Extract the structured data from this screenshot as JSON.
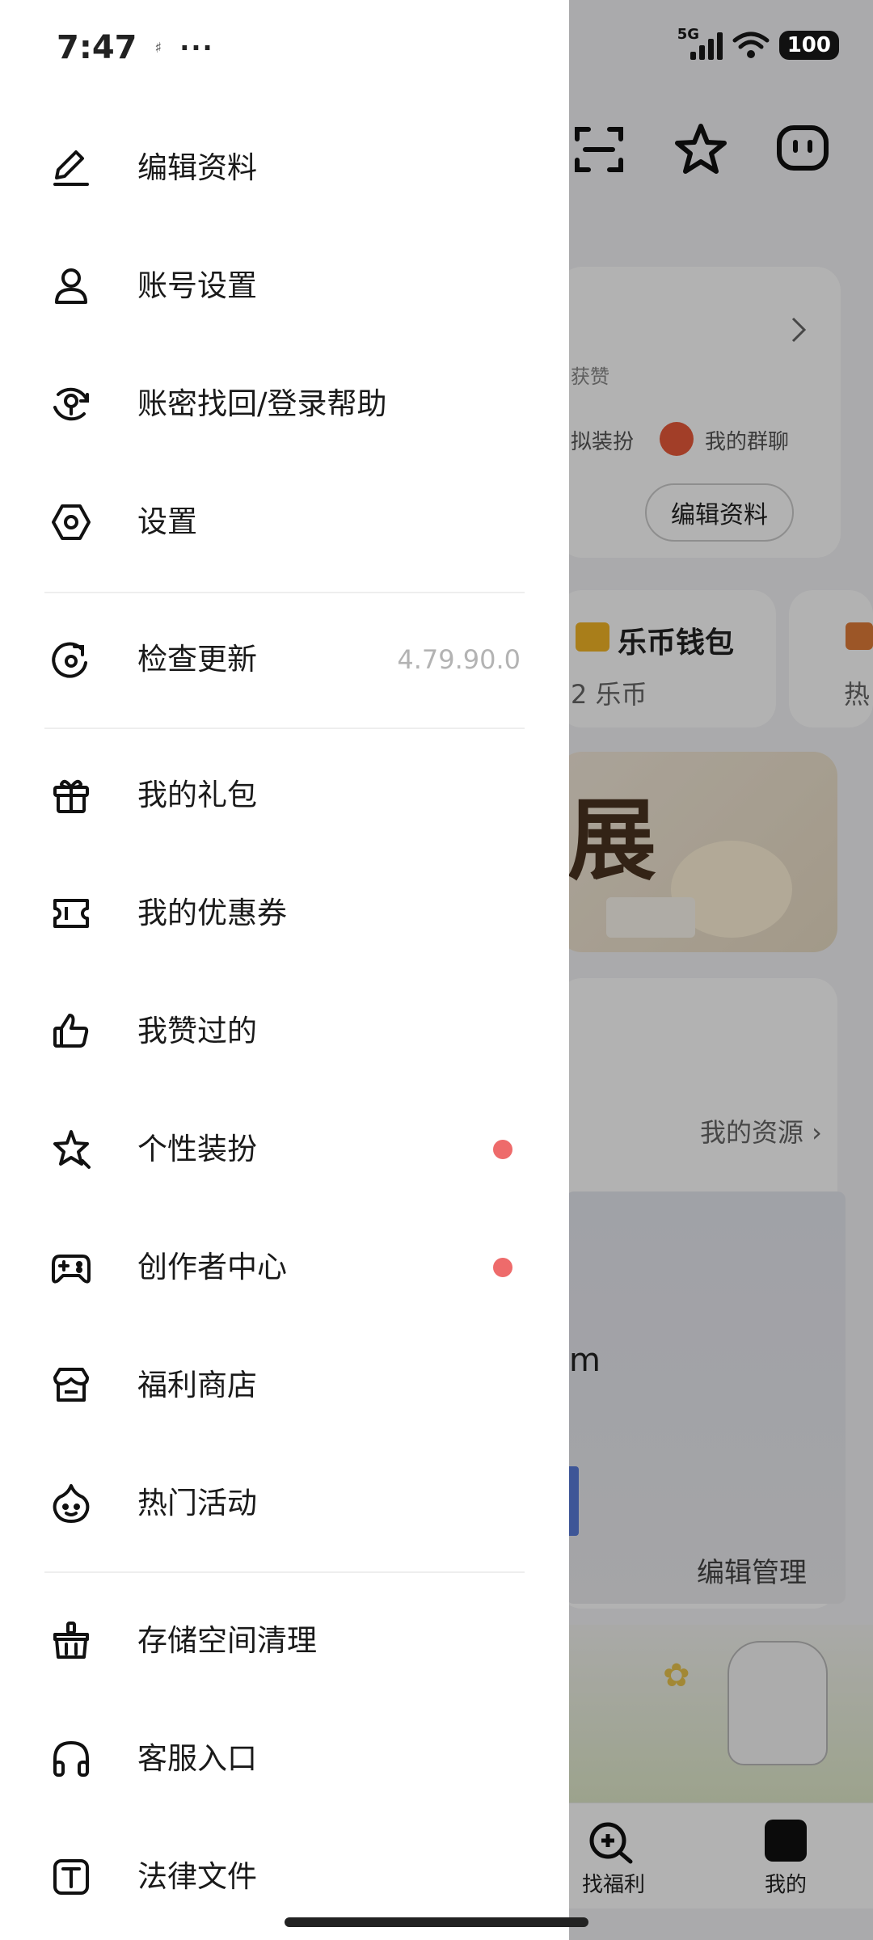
{
  "status_bar": {
    "time": "7:47",
    "more": "···",
    "network": "5G",
    "battery": "100"
  },
  "drawer": {
    "items": [
      {
        "label": "编辑资料",
        "icon": "edit-icon"
      },
      {
        "label": "账号设置",
        "icon": "user-icon"
      },
      {
        "label": "账密找回/登录帮助",
        "icon": "key-recover-icon"
      },
      {
        "label": "设置",
        "icon": "settings-icon"
      },
      {
        "label": "检查更新",
        "icon": "update-icon",
        "version": "4.79.90.0"
      },
      {
        "label": "我的礼包",
        "icon": "gift-icon"
      },
      {
        "label": "我的优惠券",
        "icon": "coupon-icon"
      },
      {
        "label": "我赞过的",
        "icon": "thumbs-up-icon"
      },
      {
        "label": "个性装扮",
        "icon": "star-dress-icon",
        "badge": true
      },
      {
        "label": "创作者中心",
        "icon": "gamepad-icon",
        "badge": true
      },
      {
        "label": "福利商店",
        "icon": "store-icon"
      },
      {
        "label": "热门活动",
        "icon": "activity-icon"
      },
      {
        "label": "存储空间清理",
        "icon": "clean-basket-icon"
      },
      {
        "label": "客服入口",
        "icon": "headphones-icon"
      },
      {
        "label": "法律文件",
        "icon": "legal-doc-icon"
      }
    ],
    "badge_color": "#ee6b6b"
  },
  "background": {
    "likes_label": "获赞",
    "dress_label": "拟装扮",
    "group_chat": "我的群聊",
    "edit_profile_button": "编辑资料",
    "wallet_title": "乐币钱包",
    "wallet_amount": "2 乐币",
    "hot_label": "热",
    "banner_text": "展",
    "my_resources": "我的资源 ›",
    "partial_m": "m",
    "manage_button": "编辑管理",
    "tab_welfare": "找福利",
    "tab_mine": "我的"
  }
}
